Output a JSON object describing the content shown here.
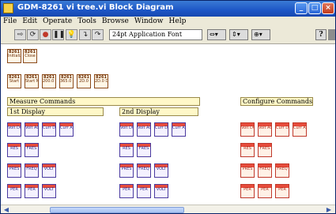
{
  "window": {
    "title": "GDM-8261 vi tree.vi Block Diagram",
    "buttons": {
      "minimize": "_",
      "maximize": "□",
      "close": "×"
    }
  },
  "menubar": [
    "File",
    "Edit",
    "Operate",
    "Tools",
    "Browse",
    "Window",
    "Help"
  ],
  "toolbar": {
    "run": "⇨",
    "run_continuous": "⟳",
    "abort": "●",
    "pause": "❚❚",
    "highlight": "💡",
    "step_into": "↴",
    "step_over": "↷",
    "step_out": "↥",
    "font": "24pt Application Font",
    "align": "⇔▾",
    "distribute": "⇕▾",
    "reorder": "⊕▾",
    "help": "?"
  },
  "colors": {
    "title_bar": "#1d56c6",
    "node_border": "#8b4a1a",
    "config_red": "#e74c3c",
    "label_bg": "#fff8c8",
    "canvas": "#ffffff"
  },
  "nodes": {
    "top": [
      {
        "l1": "8261",
        "l2": "Initialize"
      },
      {
        "l1": "8261",
        "l2": "Close"
      }
    ],
    "mid": [
      {
        "l1": "8261",
        "l2": "Start"
      },
      {
        "l1": "8261",
        "l2": "Start M."
      },
      {
        "l1": "8261",
        "l2": "200.0 WINK"
      },
      {
        "l1": "8261",
        "l2": "365.0 WINK"
      },
      {
        "l1": "8261",
        "l2": "2D.0"
      },
      {
        "l1": "8261",
        "l2": "2D.0 DCDF"
      }
    ]
  },
  "labels": {
    "measure": "Measure Commands",
    "first": "1st Display",
    "second": "2nd Display",
    "configure": "Configure Commands"
  },
  "first_display": {
    "row1": [
      "Volt DC",
      "Volt AC",
      "Curr DC",
      "Curr AC"
    ],
    "row2": [
      "RES",
      "FRES"
    ],
    "row3": [
      "PRES",
      "FREQ",
      "VOLT"
    ],
    "row4": [
      "PER",
      "PER",
      "VOLT"
    ]
  },
  "second_display": {
    "row1": [
      "Volt DC",
      "Volt AC",
      "Curr DC",
      "Curr AC"
    ],
    "row2": [
      "RES",
      "FRES"
    ],
    "row3": [
      "PRES",
      "FREQ",
      "VOLT"
    ],
    "row4": [
      "PER",
      "PER",
      "VOLT"
    ]
  },
  "configure": {
    "row1": [
      "Volt DC",
      "Volt AC",
      "Curr DC",
      "Curr AC"
    ],
    "row2": [
      "RES",
      "FRES"
    ],
    "row3": [
      "PRES",
      "FREQ",
      "FREQ"
    ],
    "row4": [
      "PER",
      "PER",
      "PER"
    ]
  }
}
